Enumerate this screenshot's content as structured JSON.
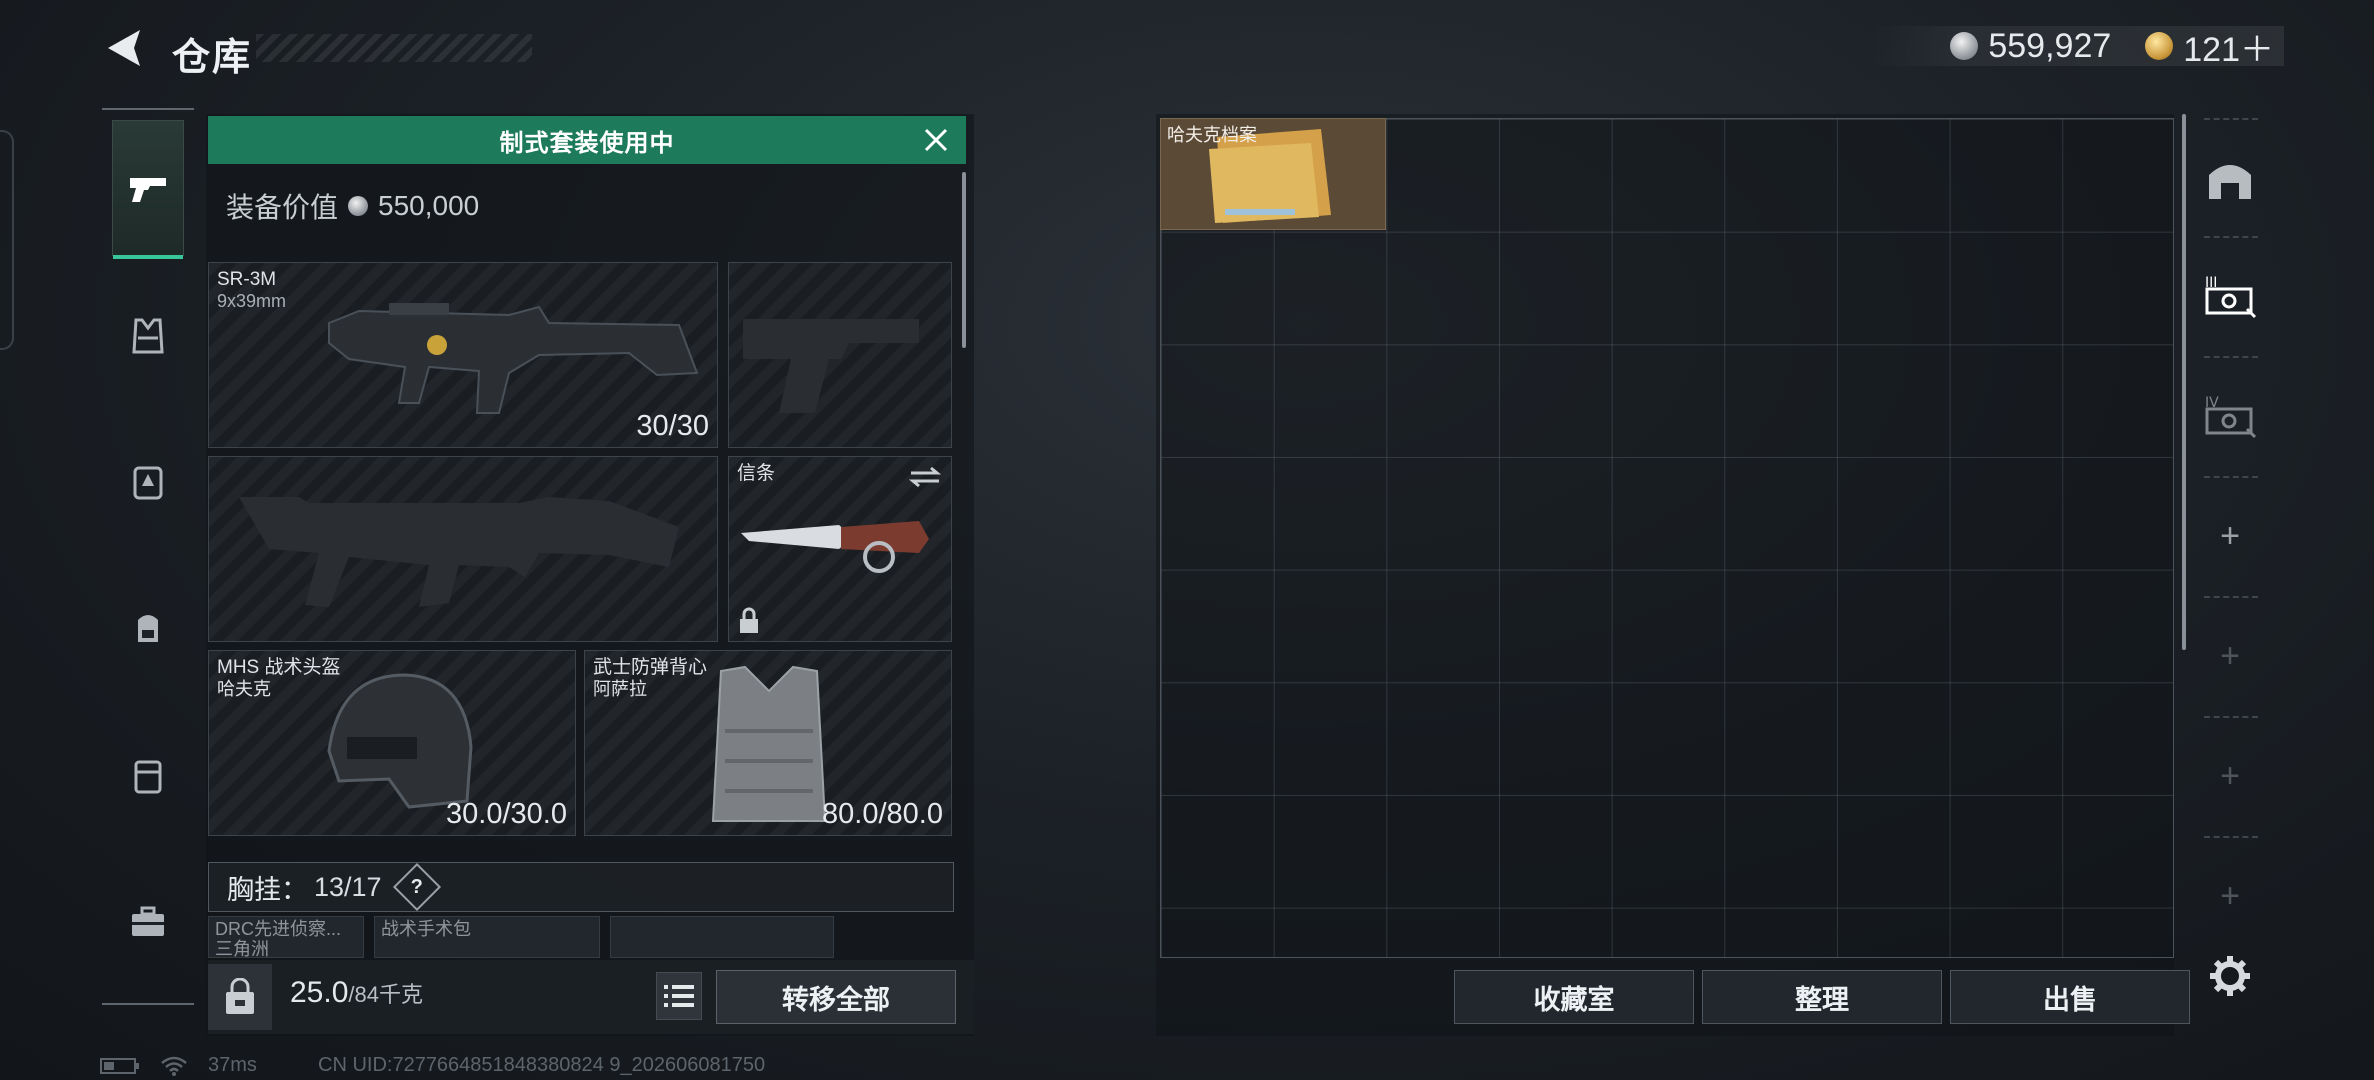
{
  "header": {
    "title": "仓库",
    "currencies": [
      {
        "icon": "silver-coin-icon",
        "value": "559,927"
      },
      {
        "icon": "gold-coin-icon",
        "value": "121＋"
      }
    ]
  },
  "nav": {
    "items": [
      {
        "icon": "pistol-icon",
        "active": true
      },
      {
        "icon": "armor-vest-icon"
      },
      {
        "icon": "chest-rig-icon"
      },
      {
        "icon": "backpack-icon"
      },
      {
        "icon": "container-icon"
      },
      {
        "icon": "briefcase-icon"
      }
    ]
  },
  "loadout": {
    "kit_banner": "制式套装使用中",
    "value_label": "装备价值",
    "value": "550,000",
    "primary": {
      "name": "SR-3M",
      "caliber": "9x39mm",
      "ammo": "30/30"
    },
    "melee": {
      "name": "信条"
    },
    "helmet": {
      "name": "MHS 战术头盔",
      "brand": "哈夫克",
      "durability": "30.0/30.0"
    },
    "armor": {
      "name": "武士防弹背心",
      "brand": "阿萨拉",
      "durability": "80.0/80.0"
    },
    "chest_rig": {
      "label": "胸挂：",
      "capacity": "13/17",
      "help": "?"
    },
    "chest_items": [
      {
        "name": "DRC先进侦察...",
        "sub": "三角洲"
      },
      {
        "name": "战术手术包",
        "sub": ""
      }
    ],
    "weight_value": "25.0",
    "weight_capacity": "/84千克",
    "transfer_all": "转移全部"
  },
  "storage": {
    "items": [
      {
        "name": "哈夫克档案"
      }
    ],
    "buttons": {
      "collection": "收藏室",
      "sort": "整理",
      "sell": "出售"
    }
  },
  "rail": {
    "items": [
      "home-shelf-icon",
      "storage-page-3-icon",
      "storage-page-4-icon"
    ],
    "add_slots": 4
  },
  "footer": {
    "ping": "37ms",
    "uid": "CN UID:7277664851848380824 9_202606081750"
  },
  "colors": {
    "accent_green": "#1d7a5a",
    "active_indicator": "#38c79a"
  }
}
